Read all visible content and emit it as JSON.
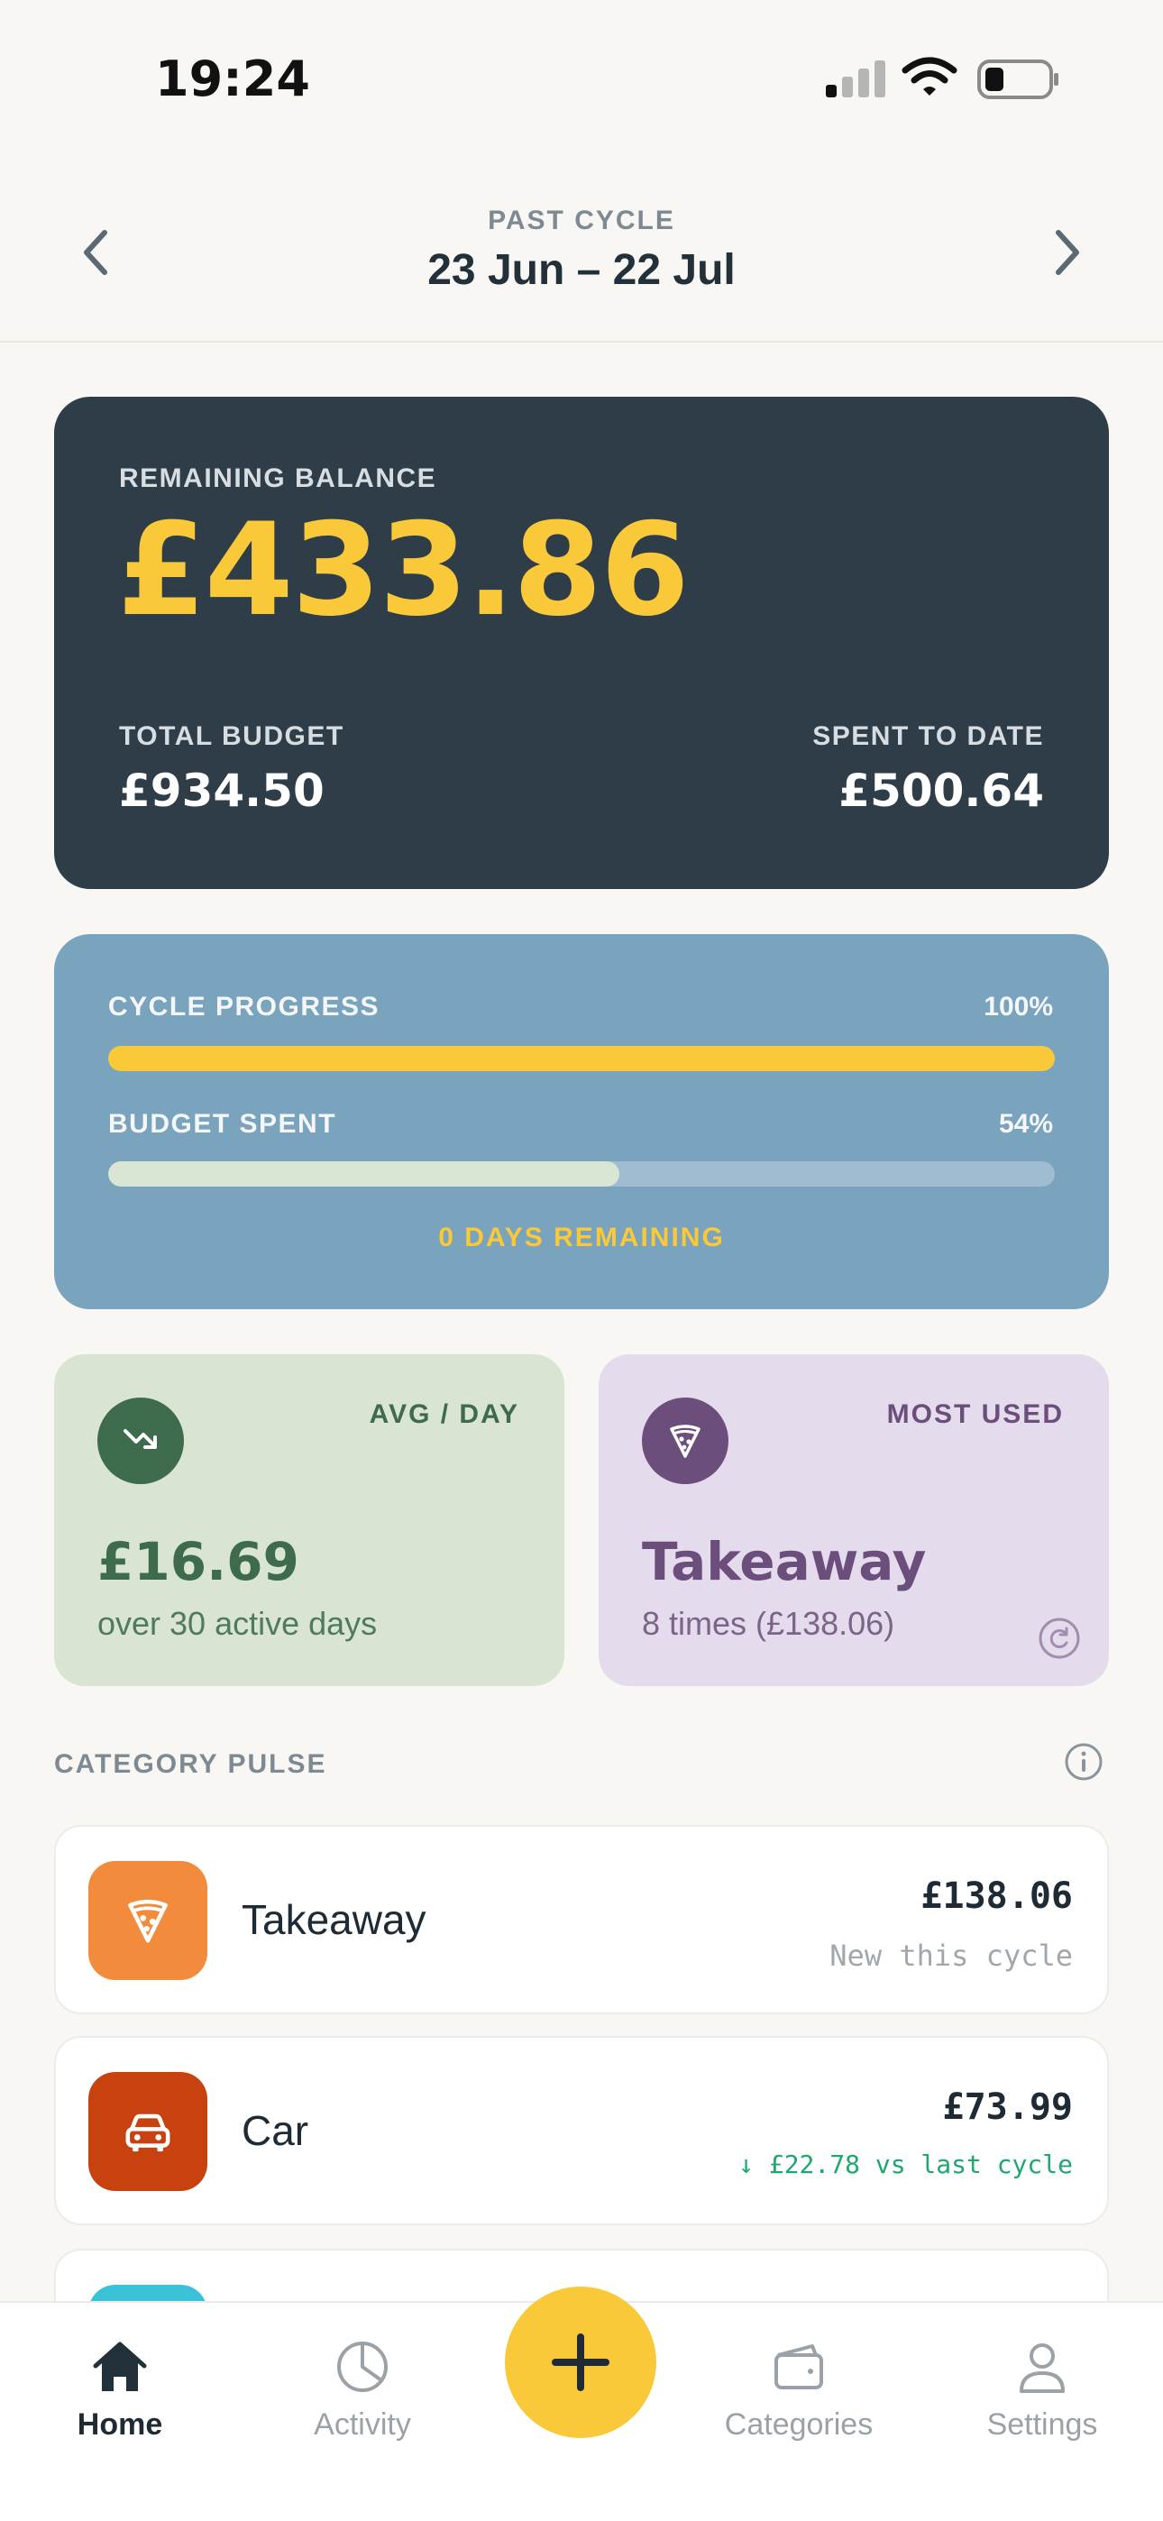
{
  "status": {
    "time": "19:24"
  },
  "header": {
    "label": "PAST CYCLE",
    "range": "23 Jun – 22 Jul"
  },
  "balance": {
    "label": "REMAINING BALANCE",
    "value": "£433.86",
    "total_budget_label": "TOTAL BUDGET",
    "total_budget": "£934.50",
    "spent_label": "SPENT TO DATE",
    "spent": "£500.64"
  },
  "progress": {
    "cycle_label": "CYCLE PROGRESS",
    "cycle_pct": "100%",
    "cycle_fraction": 1.0,
    "budget_label": "BUDGET SPENT",
    "budget_pct": "54%",
    "budget_fraction": 0.54,
    "days_remaining": "0 DAYS REMAINING",
    "colors": {
      "cycle": "#F9C93A",
      "budget": "#D9E6D3"
    }
  },
  "avg_card": {
    "label": "AVG / DAY",
    "value": "£16.69",
    "sub": "over 30 active days",
    "icon": "trending-down-icon"
  },
  "most_card": {
    "label": "MOST USED",
    "value": "Takeaway",
    "sub": "8 times (£138.06)",
    "icon": "pizza-icon"
  },
  "category_pulse": {
    "title": "CATEGORY PULSE",
    "items": [
      {
        "name": "Takeaway",
        "amount": "£138.06",
        "note": "New this cycle",
        "icon": "pizza-icon",
        "color": "#F28B3C"
      },
      {
        "name": "Car",
        "amount": "£73.99",
        "note": "↓ £22.78 vs last cycle",
        "icon": "car-icon",
        "color": "#C7420F"
      }
    ],
    "peek_color": "#3AC2D8"
  },
  "tabs": [
    {
      "label": "Home",
      "icon": "home-icon",
      "active": true
    },
    {
      "label": "Activity",
      "icon": "pie-chart-icon"
    },
    {
      "label": "Categories",
      "icon": "wallet-icon"
    },
    {
      "label": "Settings",
      "icon": "user-icon"
    }
  ],
  "colors": {
    "accent": "#F9C93A",
    "dark_card": "#2E3D48",
    "progress_card": "#7AA3BE"
  }
}
